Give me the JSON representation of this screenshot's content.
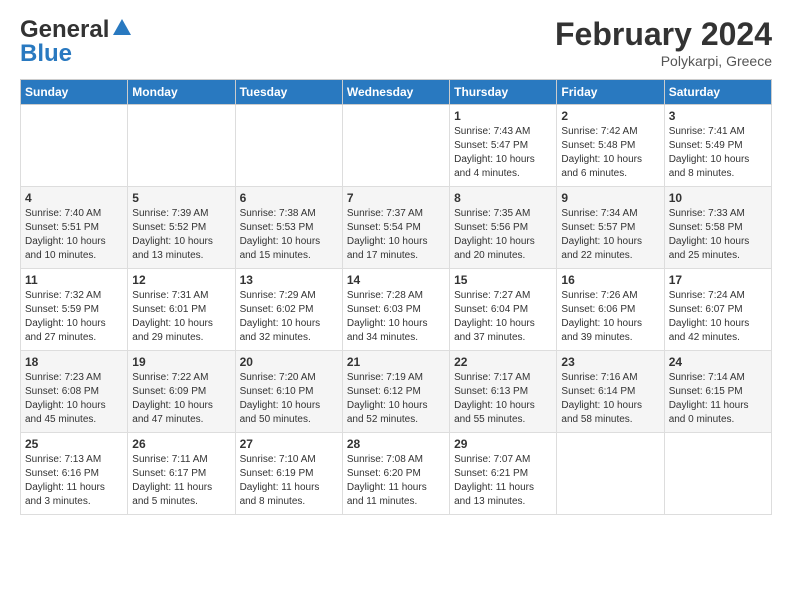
{
  "header": {
    "logo_general": "General",
    "logo_blue": "Blue",
    "month_year": "February 2024",
    "location": "Polykarpi, Greece"
  },
  "days_of_week": [
    "Sunday",
    "Monday",
    "Tuesday",
    "Wednesday",
    "Thursday",
    "Friday",
    "Saturday"
  ],
  "weeks": [
    {
      "cells": [
        {
          "empty": true
        },
        {
          "empty": true
        },
        {
          "empty": true
        },
        {
          "empty": true
        },
        {
          "day": 1,
          "sunrise": "7:43 AM",
          "sunset": "5:47 PM",
          "daylight": "10 hours and 4 minutes."
        },
        {
          "day": 2,
          "sunrise": "7:42 AM",
          "sunset": "5:48 PM",
          "daylight": "10 hours and 6 minutes."
        },
        {
          "day": 3,
          "sunrise": "7:41 AM",
          "sunset": "5:49 PM",
          "daylight": "10 hours and 8 minutes."
        }
      ]
    },
    {
      "cells": [
        {
          "day": 4,
          "sunrise": "7:40 AM",
          "sunset": "5:51 PM",
          "daylight": "10 hours and 10 minutes."
        },
        {
          "day": 5,
          "sunrise": "7:39 AM",
          "sunset": "5:52 PM",
          "daylight": "10 hours and 13 minutes."
        },
        {
          "day": 6,
          "sunrise": "7:38 AM",
          "sunset": "5:53 PM",
          "daylight": "10 hours and 15 minutes."
        },
        {
          "day": 7,
          "sunrise": "7:37 AM",
          "sunset": "5:54 PM",
          "daylight": "10 hours and 17 minutes."
        },
        {
          "day": 8,
          "sunrise": "7:35 AM",
          "sunset": "5:56 PM",
          "daylight": "10 hours and 20 minutes."
        },
        {
          "day": 9,
          "sunrise": "7:34 AM",
          "sunset": "5:57 PM",
          "daylight": "10 hours and 22 minutes."
        },
        {
          "day": 10,
          "sunrise": "7:33 AM",
          "sunset": "5:58 PM",
          "daylight": "10 hours and 25 minutes."
        }
      ]
    },
    {
      "cells": [
        {
          "day": 11,
          "sunrise": "7:32 AM",
          "sunset": "5:59 PM",
          "daylight": "10 hours and 27 minutes."
        },
        {
          "day": 12,
          "sunrise": "7:31 AM",
          "sunset": "6:01 PM",
          "daylight": "10 hours and 29 minutes."
        },
        {
          "day": 13,
          "sunrise": "7:29 AM",
          "sunset": "6:02 PM",
          "daylight": "10 hours and 32 minutes."
        },
        {
          "day": 14,
          "sunrise": "7:28 AM",
          "sunset": "6:03 PM",
          "daylight": "10 hours and 34 minutes."
        },
        {
          "day": 15,
          "sunrise": "7:27 AM",
          "sunset": "6:04 PM",
          "daylight": "10 hours and 37 minutes."
        },
        {
          "day": 16,
          "sunrise": "7:26 AM",
          "sunset": "6:06 PM",
          "daylight": "10 hours and 39 minutes."
        },
        {
          "day": 17,
          "sunrise": "7:24 AM",
          "sunset": "6:07 PM",
          "daylight": "10 hours and 42 minutes."
        }
      ]
    },
    {
      "cells": [
        {
          "day": 18,
          "sunrise": "7:23 AM",
          "sunset": "6:08 PM",
          "daylight": "10 hours and 45 minutes."
        },
        {
          "day": 19,
          "sunrise": "7:22 AM",
          "sunset": "6:09 PM",
          "daylight": "10 hours and 47 minutes."
        },
        {
          "day": 20,
          "sunrise": "7:20 AM",
          "sunset": "6:10 PM",
          "daylight": "10 hours and 50 minutes."
        },
        {
          "day": 21,
          "sunrise": "7:19 AM",
          "sunset": "6:12 PM",
          "daylight": "10 hours and 52 minutes."
        },
        {
          "day": 22,
          "sunrise": "7:17 AM",
          "sunset": "6:13 PM",
          "daylight": "10 hours and 55 minutes."
        },
        {
          "day": 23,
          "sunrise": "7:16 AM",
          "sunset": "6:14 PM",
          "daylight": "10 hours and 58 minutes."
        },
        {
          "day": 24,
          "sunrise": "7:14 AM",
          "sunset": "6:15 PM",
          "daylight": "11 hours and 0 minutes."
        }
      ]
    },
    {
      "cells": [
        {
          "day": 25,
          "sunrise": "7:13 AM",
          "sunset": "6:16 PM",
          "daylight": "11 hours and 3 minutes."
        },
        {
          "day": 26,
          "sunrise": "7:11 AM",
          "sunset": "6:17 PM",
          "daylight": "11 hours and 5 minutes."
        },
        {
          "day": 27,
          "sunrise": "7:10 AM",
          "sunset": "6:19 PM",
          "daylight": "11 hours and 8 minutes."
        },
        {
          "day": 28,
          "sunrise": "7:08 AM",
          "sunset": "6:20 PM",
          "daylight": "11 hours and 11 minutes."
        },
        {
          "day": 29,
          "sunrise": "7:07 AM",
          "sunset": "6:21 PM",
          "daylight": "11 hours and 13 minutes."
        },
        {
          "empty": true
        },
        {
          "empty": true
        }
      ]
    }
  ]
}
